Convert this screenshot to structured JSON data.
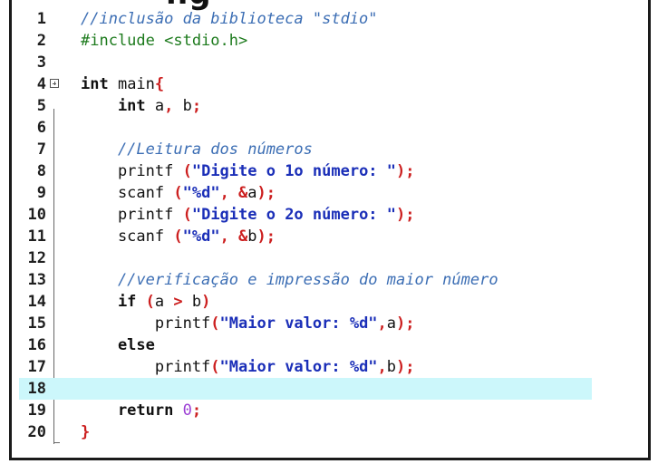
{
  "fragment_text": "ng",
  "lines": [
    {
      "n": "1",
      "parts": [
        {
          "t": "//inclusão da biblioteca \"stdio\"",
          "c": "comment"
        }
      ]
    },
    {
      "n": "2",
      "parts": [
        {
          "t": "#include <stdio.h>",
          "c": "preproc"
        }
      ]
    },
    {
      "n": "3",
      "parts": []
    },
    {
      "n": "4",
      "parts": [
        {
          "t": "int",
          "c": "type"
        },
        {
          "t": " main",
          "c": "ident"
        },
        {
          "t": "{",
          "c": "punct"
        }
      ]
    },
    {
      "n": "5",
      "parts": [
        {
          "t": "    int",
          "c": "type"
        },
        {
          "t": " a",
          "c": "ident"
        },
        {
          "t": ",",
          "c": "punct"
        },
        {
          "t": " b",
          "c": "ident"
        },
        {
          "t": ";",
          "c": "punct"
        }
      ]
    },
    {
      "n": "6",
      "parts": []
    },
    {
      "n": "7",
      "parts": [
        {
          "t": "    //Leitura dos números",
          "c": "comment"
        }
      ]
    },
    {
      "n": "8",
      "parts": [
        {
          "t": "    printf ",
          "c": "ident"
        },
        {
          "t": "(",
          "c": "punct"
        },
        {
          "t": "\"Digite o 1o número: \"",
          "c": "string"
        },
        {
          "t": ");",
          "c": "punct"
        }
      ]
    },
    {
      "n": "9",
      "parts": [
        {
          "t": "    scanf ",
          "c": "ident"
        },
        {
          "t": "(",
          "c": "punct"
        },
        {
          "t": "\"%d\"",
          "c": "string"
        },
        {
          "t": ", &",
          "c": "punct"
        },
        {
          "t": "a",
          "c": "ident"
        },
        {
          "t": ");",
          "c": "punct"
        }
      ]
    },
    {
      "n": "10",
      "parts": [
        {
          "t": "    printf ",
          "c": "ident"
        },
        {
          "t": "(",
          "c": "punct"
        },
        {
          "t": "\"Digite o 2o número: \"",
          "c": "string"
        },
        {
          "t": ");",
          "c": "punct"
        }
      ]
    },
    {
      "n": "11",
      "parts": [
        {
          "t": "    scanf ",
          "c": "ident"
        },
        {
          "t": "(",
          "c": "punct"
        },
        {
          "t": "\"%d\"",
          "c": "string"
        },
        {
          "t": ", &",
          "c": "punct"
        },
        {
          "t": "b",
          "c": "ident"
        },
        {
          "t": ");",
          "c": "punct"
        }
      ]
    },
    {
      "n": "12",
      "parts": []
    },
    {
      "n": "13",
      "parts": [
        {
          "t": "    //verificação e impressão do maior número",
          "c": "comment"
        }
      ]
    },
    {
      "n": "14",
      "parts": [
        {
          "t": "    if",
          "c": "keyword"
        },
        {
          "t": " (",
          "c": "punct"
        },
        {
          "t": "a",
          "c": "ident"
        },
        {
          "t": " > ",
          "c": "punct"
        },
        {
          "t": "b",
          "c": "ident"
        },
        {
          "t": ")",
          "c": "punct"
        }
      ]
    },
    {
      "n": "15",
      "parts": [
        {
          "t": "        printf",
          "c": "ident"
        },
        {
          "t": "(",
          "c": "punct"
        },
        {
          "t": "\"Maior valor: %d\"",
          "c": "string"
        },
        {
          "t": ",",
          "c": "punct"
        },
        {
          "t": "a",
          "c": "ident"
        },
        {
          "t": ");",
          "c": "punct"
        }
      ]
    },
    {
      "n": "16",
      "parts": [
        {
          "t": "    else",
          "c": "keyword"
        }
      ]
    },
    {
      "n": "17",
      "parts": [
        {
          "t": "        printf",
          "c": "ident"
        },
        {
          "t": "(",
          "c": "punct"
        },
        {
          "t": "\"Maior valor: %d\"",
          "c": "string"
        },
        {
          "t": ",",
          "c": "punct"
        },
        {
          "t": "b",
          "c": "ident"
        },
        {
          "t": ");",
          "c": "punct"
        }
      ]
    },
    {
      "n": "18",
      "parts": [],
      "current": true
    },
    {
      "n": "19",
      "parts": [
        {
          "t": "    return",
          "c": "keyword"
        },
        {
          "t": " ",
          "c": "ident"
        },
        {
          "t": "0",
          "c": "number"
        },
        {
          "t": ";",
          "c": "punct"
        }
      ]
    },
    {
      "n": "20",
      "parts": [
        {
          "t": "}",
          "c": "punct"
        }
      ]
    }
  ],
  "colors": {
    "comment": "#3c6eb4",
    "preproc": "#1c7a1c",
    "string": "#1b2fb8",
    "punct": "#cc1f1f",
    "number": "#9c3fd4",
    "current_line": "#ccf7fb"
  },
  "icons": {
    "fold": "fold-collapse-icon"
  }
}
